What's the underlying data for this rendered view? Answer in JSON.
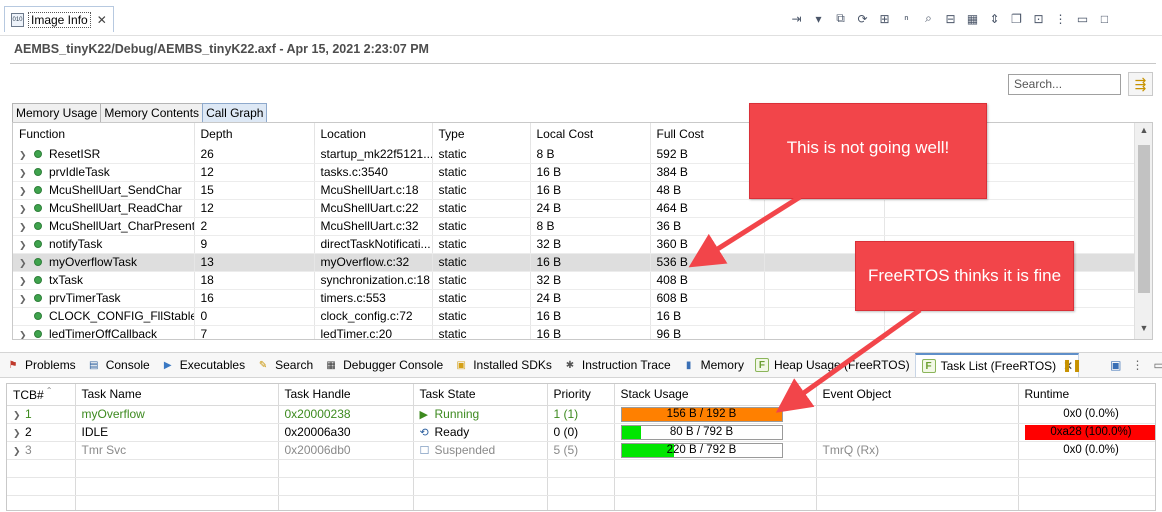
{
  "view": {
    "title": "Image Info"
  },
  "toolbar_icons": [
    "import-icon",
    "dropdown-icon",
    "copy-icon",
    "refresh-icon",
    "binary-icon",
    "hex-icon",
    "search-icon",
    "compare-icon",
    "bits-icon",
    "expand-icon",
    "pages-icon",
    "new-window-icon",
    "view-menu-icon",
    "minimize-icon",
    "maximize-icon"
  ],
  "subtitle": "AEMBS_tinyK22/Debug/AEMBS_tinyK22.axf - Apr 15, 2021 2:23:07 PM",
  "search": {
    "placeholder": "Search..."
  },
  "inner_tabs": [
    "Memory Usage",
    "Memory Contents",
    "Call Graph"
  ],
  "call_graph": {
    "columns": [
      "Function",
      "Depth",
      "Location",
      "Type",
      "Local Cost",
      "Full Cost",
      "",
      ""
    ],
    "rows": [
      {
        "expandable": true,
        "function": "ResetISR",
        "depth": "26",
        "location": "startup_mk22f5121...",
        "type": "static",
        "local": "8 B",
        "full": "592 B",
        "selected": false
      },
      {
        "expandable": true,
        "function": "prvIdleTask",
        "depth": "12",
        "location": "tasks.c:3540",
        "type": "static",
        "local": "16 B",
        "full": "384 B",
        "selected": false
      },
      {
        "expandable": true,
        "function": "McuShellUart_SendChar",
        "depth": "15",
        "location": "McuShellUart.c:18",
        "type": "static",
        "local": "16 B",
        "full": "48 B",
        "selected": false
      },
      {
        "expandable": true,
        "function": "McuShellUart_ReadChar",
        "depth": "12",
        "location": "McuShellUart.c:22",
        "type": "static",
        "local": "24 B",
        "full": "464 B",
        "selected": false
      },
      {
        "expandable": true,
        "function": "McuShellUart_CharPresent",
        "depth": "2",
        "location": "McuShellUart.c:32",
        "type": "static",
        "local": "8 B",
        "full": "36 B",
        "selected": false
      },
      {
        "expandable": true,
        "function": "notifyTask",
        "depth": "9",
        "location": "directTaskNotificati...",
        "type": "static",
        "local": "32 B",
        "full": "360 B",
        "selected": false
      },
      {
        "expandable": true,
        "function": "myOverflowTask",
        "depth": "13",
        "location": "myOverflow.c:32",
        "type": "static",
        "local": "16 B",
        "full": "536 B",
        "selected": true
      },
      {
        "expandable": true,
        "function": "txTask",
        "depth": "18",
        "location": "synchronization.c:18",
        "type": "static",
        "local": "32 B",
        "full": "408 B",
        "selected": false
      },
      {
        "expandable": true,
        "function": "prvTimerTask",
        "depth": "16",
        "location": "timers.c:553",
        "type": "static",
        "local": "24 B",
        "full": "608 B",
        "selected": false
      },
      {
        "expandable": false,
        "function": "CLOCK_CONFIG_FllStableDe",
        "depth": "0",
        "location": "clock_config.c:72",
        "type": "static",
        "local": "16 B",
        "full": "16 B",
        "selected": false
      },
      {
        "expandable": true,
        "function": "ledTimerOffCallback",
        "depth": "7",
        "location": "ledTimer.c:20",
        "type": "static",
        "local": "16 B",
        "full": "96 B",
        "selected": false
      }
    ]
  },
  "bottom_tabs": [
    {
      "label": "Problems",
      "icon": "problems-icon",
      "color": "#c0392b"
    },
    {
      "label": "Console",
      "icon": "console-icon",
      "color": "#2c5f9e"
    },
    {
      "label": "Executables",
      "icon": "executables-icon",
      "color": "#3a78c3"
    },
    {
      "label": "Search",
      "icon": "search-flashlight-icon",
      "color": "#c79200"
    },
    {
      "label": "Debugger Console",
      "icon": "debugger-console-icon",
      "color": "#3b3b3b"
    },
    {
      "label": "Installed SDKs",
      "icon": "sdk-icon",
      "color": "#d4a017"
    },
    {
      "label": "Instruction Trace",
      "icon": "instruction-trace-icon",
      "color": "#555555"
    },
    {
      "label": "Memory",
      "icon": "memory-icon",
      "color": "#3a6fb5"
    },
    {
      "label": "Heap Usage (FreeRTOS)",
      "icon": "freertos-f-icon",
      "color": "#6a9e2f"
    },
    {
      "label": "Task List (FreeRTOS)",
      "icon": "freertos-f-icon",
      "color": "#6a9e2f"
    }
  ],
  "task_list": {
    "columns": [
      "TCB#",
      "Task Name",
      "Task Handle",
      "Task State",
      "Priority",
      "Stack Usage",
      "Event Object",
      "Runtime"
    ],
    "rows": [
      {
        "tcb": "1",
        "name": "myOverflow",
        "handle": "0x20000238",
        "state": "Running",
        "state_icon": "play-icon",
        "priority": "1 (1)",
        "stack": "156 B / 192 B",
        "stack_fraction": 1.0,
        "stack_color": "#ff8000",
        "event": "",
        "runtime": "0x0 (0.0%)",
        "runtime_fraction": 0.0,
        "style": "green"
      },
      {
        "tcb": "2",
        "name": "IDLE",
        "handle": "0x20006a30",
        "state": "Ready",
        "state_icon": "ready-icon",
        "priority": "0 (0)",
        "stack": "80 B / 792 B",
        "stack_fraction": 0.12,
        "stack_color": "#00e600",
        "event": "",
        "runtime": "0xa28 (100.0%)",
        "runtime_fraction": 1.0,
        "style": "normal"
      },
      {
        "tcb": "3",
        "name": "Tmr Svc",
        "handle": "0x20006db0",
        "state": "Suspended",
        "state_icon": "suspended-icon",
        "priority": "5 (5)",
        "stack": "220 B / 792 B",
        "stack_fraction": 0.33,
        "stack_color": "#00e600",
        "event": "TmrQ (Rx)",
        "runtime": "0x0 (0.0%)",
        "runtime_fraction": 0.0,
        "style": "gray"
      }
    ]
  },
  "callouts": {
    "first": "This is not going well!",
    "second": "FreeRTOS thinks it is fine"
  },
  "colors": {
    "callout": "#f2454a",
    "runtime_full": "#ff0000",
    "selection": "#dedede"
  }
}
